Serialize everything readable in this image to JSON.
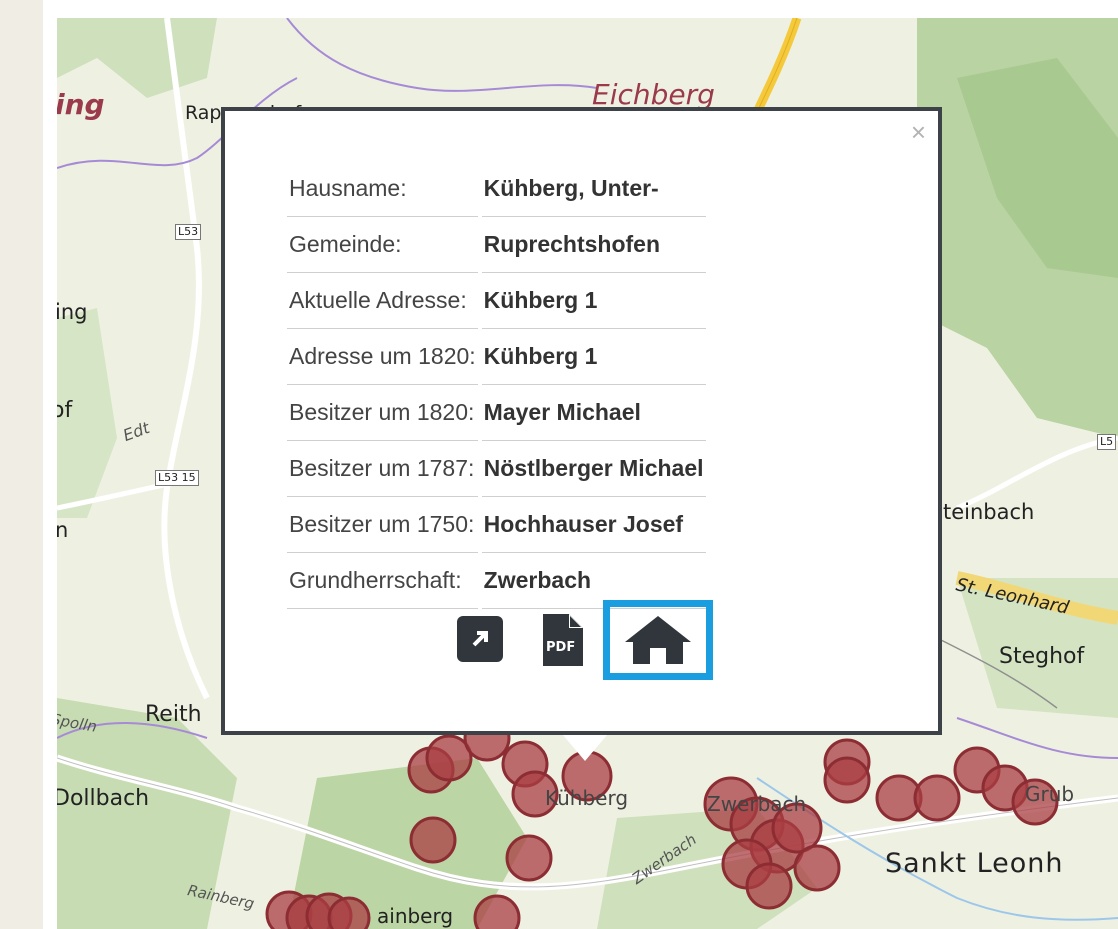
{
  "map": {
    "places": [
      {
        "id": "ing-top",
        "text": "ing"
      },
      {
        "id": "rappersdorf",
        "text": "Rappersdorf"
      },
      {
        "id": "eichberg",
        "text": "Eichberg"
      },
      {
        "id": "ing-left",
        "text": "ing"
      },
      {
        "id": "of",
        "text": "of"
      },
      {
        "id": "edt",
        "text": "Edt"
      },
      {
        "id": "n",
        "text": "n"
      },
      {
        "id": "steinbach",
        "text": "teinbach"
      },
      {
        "id": "st-leonhard-road",
        "text": "St. Leonhard"
      },
      {
        "id": "steghof",
        "text": "Steghof"
      },
      {
        "id": "reith",
        "text": "Reith"
      },
      {
        "id": "spolln",
        "text": "Spolln"
      },
      {
        "id": "dollbach",
        "text": "Dollbach"
      },
      {
        "id": "kuehberg",
        "text": "Kühberg"
      },
      {
        "id": "zwerbach",
        "text": "Zwerbach"
      },
      {
        "id": "grub",
        "text": "Grub"
      },
      {
        "id": "sankt-leonhard",
        "text": "Sankt Leonh"
      },
      {
        "id": "zwerbach-river",
        "text": "Zwerbach"
      },
      {
        "id": "rainberg",
        "text": "Rainberg"
      },
      {
        "id": "ainberg",
        "text": "ainberg"
      }
    ],
    "road_labels": [
      {
        "id": "l53-a",
        "text": "L53"
      },
      {
        "id": "l5315",
        "text": "L53 15"
      },
      {
        "id": "l5-right",
        "text": "L5"
      }
    ]
  },
  "popup": {
    "close_label": "×",
    "rows": [
      {
        "key": "Hausname:",
        "value": "Kühberg, Unter-"
      },
      {
        "key": "Gemeinde:",
        "value": "Ruprechtshofen"
      },
      {
        "key": "Aktuelle Adresse:",
        "value": "Kühberg 1"
      },
      {
        "key": "Adresse um 1820:",
        "value": "Kühberg 1"
      },
      {
        "key": "Besitzer um 1820:",
        "value": "Mayer Michael"
      },
      {
        "key": "Besitzer um 1787:",
        "value": "Nöstlberger Michael"
      },
      {
        "key": "Besitzer um 1750:",
        "value": "Hochhauser Josef"
      },
      {
        "key": "Grundherrschaft:",
        "value": "Zwerbach"
      }
    ],
    "actions": {
      "open_icon": "external-link-icon",
      "pdf_icon": "pdf-icon",
      "pdf_label": "PDF",
      "home_icon": "home-icon",
      "home_highlight_color": "#1a9ee0"
    }
  }
}
